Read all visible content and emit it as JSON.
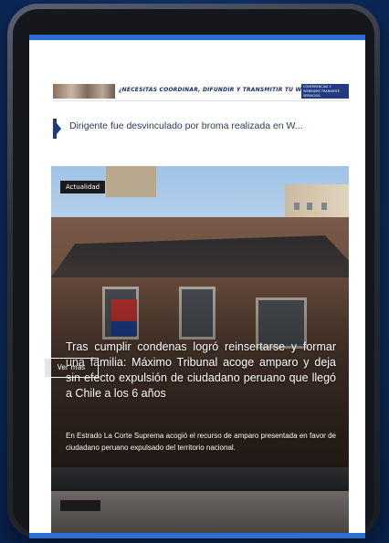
{
  "banner": {
    "text": "¿NECESITAS COORDINAR, DIFUNDIR Y TRANSMITIR TU WEBINAR?",
    "badge": "CONFERENCIAS Y WEBINARS TRANSMITE SERVICIOS"
  },
  "ticker": {
    "text": "Dirigente fue desvinculado por broma realizada en W..."
  },
  "featured": {
    "category": "Actualidad",
    "headline": "Tras cumplir condenas logró reinsertarse y formar una familia: Máximo Tribunal acoge amparo y deja sin efecto expulsión de ciudadano peruano que llegó a Chile a los 6 años",
    "summary": "En Estrado La Corte Suprema acogió el recurso de amparo presentada en favor de ciudadano peruano expulsado del territorio nacional.",
    "read_more": "Ver más"
  },
  "colors": {
    "accent": "#2c6fd1",
    "ticker_marker": "#1f3c73",
    "background": "#0d2a5a"
  }
}
